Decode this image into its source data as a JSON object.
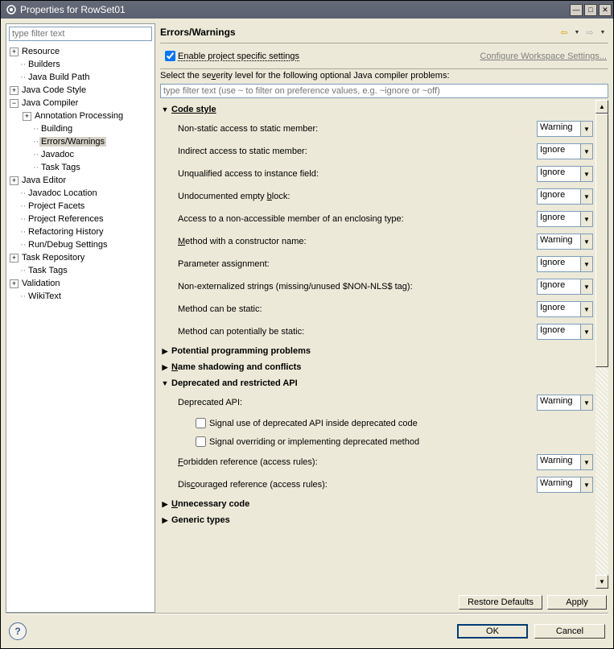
{
  "title": "Properties for RowSet01",
  "left_filter_placeholder": "type filter text",
  "tree": {
    "resource": "Resource",
    "builders": "Builders",
    "java_build_path": "Java Build Path",
    "java_code_style": "Java Code Style",
    "java_compiler": "Java Compiler",
    "annotation_processing": "Annotation Processing",
    "building": "Building",
    "errors_warnings": "Errors/Warnings",
    "javadoc": "Javadoc",
    "task_tags": "Task Tags",
    "java_editor": "Java Editor",
    "javadoc_location": "Javadoc Location",
    "project_facets": "Project Facets",
    "project_references": "Project References",
    "refactoring_history": "Refactoring History",
    "run_debug": "Run/Debug Settings",
    "task_repository": "Task Repository",
    "task_tags2": "Task Tags",
    "validation": "Validation",
    "wikitext": "WikiText"
  },
  "page": {
    "title": "Errors/Warnings",
    "enable": "Enable project specific settings",
    "configure_link": "Configure Workspace Settings...",
    "desc_pre": "Select the se",
    "desc_u": "v",
    "desc_post": "erity level for the following optional Java compiler problems:",
    "filter_placeholder": "type filter text (use ~ to filter on preference values, e.g. ~ignore or ~off)"
  },
  "sections": {
    "code_style": "Code style",
    "potential": "Potential programming problems",
    "name_shadow": "Name shadowing and conflicts",
    "deprecated": "Deprecated and restricted API",
    "unnecessary": "Unnecessary code",
    "generic": "Generic types"
  },
  "options": {
    "non_static": "Non-static access to static member:",
    "indirect": "Indirect access to static member:",
    "unqualified": "Unqualified access to instance field:",
    "undocumented_pre": "Undocumented empty ",
    "undocumented_u": "b",
    "undocumented_post": "lock:",
    "access_enclosing": "Access to a non-accessible member of an enclosing type:",
    "method_ctor_u": "M",
    "method_ctor_post": "ethod with a constructor name:",
    "param_assign": "Parameter assignment:",
    "non_externalized": "Non-externalized strings (missing/unused $NON-NLS$ tag):",
    "can_static": "Method can be static:",
    "can_pot_static": "Method can potentially be static:",
    "deprecated_api": "Deprecated API:",
    "signal_inside": "Signal use of deprecated API inside deprecated code",
    "signal_override": "Signal overriding or implementing deprecated method",
    "forbidden_u": "F",
    "forbidden_post": "orbidden reference (access rules):",
    "discouraged_pre": "Dis",
    "discouraged_u": "c",
    "discouraged_post": "ouraged reference (access rules):"
  },
  "values": {
    "warning": "Warning",
    "ignore": "Ignore"
  },
  "buttons": {
    "restore": "Restore Defaults",
    "apply": "Apply",
    "ok": "OK",
    "cancel": "Cancel"
  }
}
